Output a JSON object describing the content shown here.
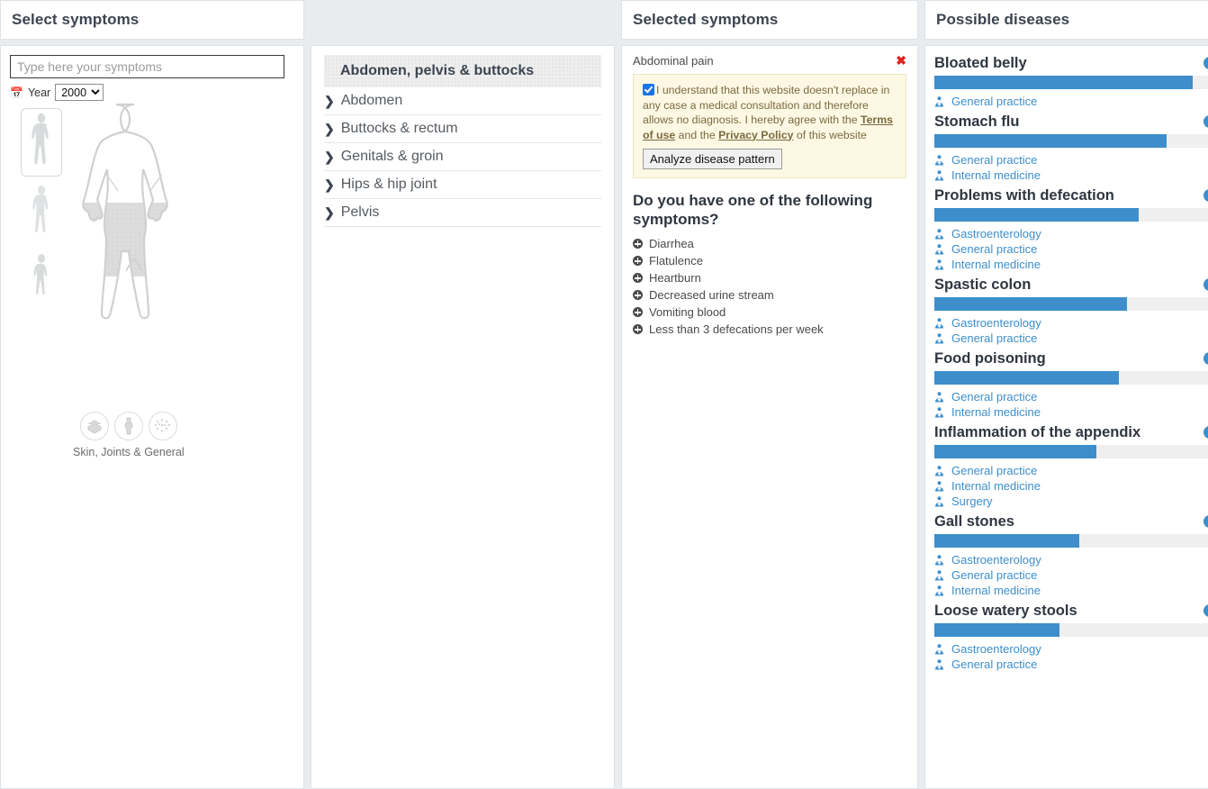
{
  "panels": {
    "select": {
      "title": "Select symptoms"
    },
    "region": {
      "title": ""
    },
    "selected": {
      "title": "Selected symptoms"
    },
    "diseases": {
      "title": "Possible diseases"
    }
  },
  "search": {
    "placeholder": "Type here your symptoms",
    "value": ""
  },
  "year": {
    "icon": "calendar-icon",
    "label": "Year",
    "selected": "2000",
    "options": [
      "2000"
    ]
  },
  "figures": {
    "items": [
      {
        "name": "man",
        "selected": true
      },
      {
        "name": "woman",
        "selected": false
      },
      {
        "name": "child",
        "selected": false
      }
    ],
    "highlighted_region": "abdomen-pelvis-buttocks"
  },
  "categories": {
    "label": "Skin, Joints & General",
    "icons": [
      "skin-icon",
      "joints-icon",
      "general-icon"
    ]
  },
  "region": {
    "title": "Abdomen, pelvis & buttocks",
    "items": [
      {
        "label": "Abdomen"
      },
      {
        "label": "Buttocks & rectum"
      },
      {
        "label": "Genitals & groin"
      },
      {
        "label": "Hips & hip joint"
      },
      {
        "label": "Pelvis"
      }
    ]
  },
  "selected_symptoms": {
    "items": [
      {
        "label": "Abdominal pain"
      }
    ],
    "remove_icon": "✖"
  },
  "consent": {
    "checked": true,
    "text_part1": "I understand that this website doesn't replace in any case a medical consultation and therefore allows no diagnosis. I hereby agree with the ",
    "link_terms": "Terms of use",
    "text_part2": " and the ",
    "link_privacy": "Privacy Policy",
    "text_part3": " of this website",
    "button_label": "Analyze disease pattern"
  },
  "suggestions": {
    "title": "Do you have one of the following symptoms?",
    "items": [
      {
        "label": "Diarrhea"
      },
      {
        "label": "Flatulence"
      },
      {
        "label": "Heartburn"
      },
      {
        "label": "Decreased urine stream"
      },
      {
        "label": "Vomiting blood"
      },
      {
        "label": "Less than 3 defecations per week"
      }
    ]
  },
  "colors": {
    "accent_blue": "#3d8ecb",
    "bar_track": "#efefef",
    "consent_bg": "#fdf8e3",
    "panel_bg": "#ffffff",
    "page_bg": "#e9ecef",
    "close_red": "#e02020"
  },
  "diseases": {
    "items": [
      {
        "name": "Bloated belly",
        "match": 91,
        "specialties": [
          "General practice"
        ]
      },
      {
        "name": "Stomach flu",
        "match": 82,
        "specialties": [
          "General practice",
          "Internal medicine"
        ]
      },
      {
        "name": "Problems with defecation",
        "match": 72,
        "specialties": [
          "Gastroenterology",
          "General practice",
          "Internal medicine"
        ]
      },
      {
        "name": "Spastic colon",
        "match": 68,
        "specialties": [
          "Gastroenterology",
          "General practice"
        ]
      },
      {
        "name": "Food poisoning",
        "match": 65,
        "specialties": [
          "General practice",
          "Internal medicine"
        ]
      },
      {
        "name": "Inflammation of the appendix",
        "match": 57,
        "specialties": [
          "General practice",
          "Internal medicine",
          "Surgery"
        ]
      },
      {
        "name": "Gall stones",
        "match": 51,
        "specialties": [
          "Gastroenterology",
          "General practice",
          "Internal medicine"
        ]
      },
      {
        "name": "Loose watery stools",
        "match": 44,
        "specialties": [
          "Gastroenterology",
          "General practice"
        ]
      }
    ],
    "info_glyph": "i",
    "specialty_icon": "doctor-icon"
  }
}
